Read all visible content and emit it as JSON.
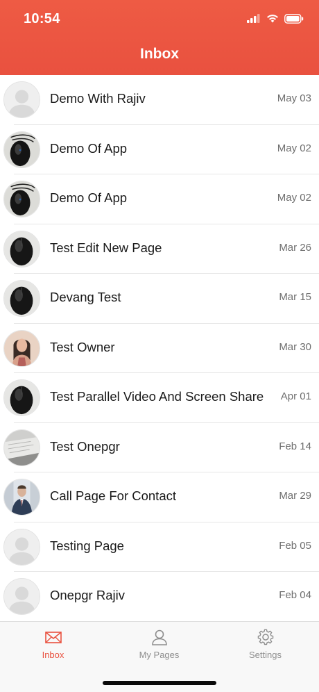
{
  "status_bar": {
    "time": "10:54"
  },
  "header": {
    "title": "Inbox",
    "color": "#e9513f"
  },
  "inbox": {
    "items": [
      {
        "name": "Demo With Rajiv",
        "date": "May 03",
        "avatar": "placeholder"
      },
      {
        "name": "Demo Of App",
        "date": "May 02",
        "avatar": "mouse-cable"
      },
      {
        "name": "Demo Of App",
        "date": "May 02",
        "avatar": "mouse-cable"
      },
      {
        "name": "Test Edit New Page",
        "date": "Mar 26",
        "avatar": "mouse"
      },
      {
        "name": "Devang Test",
        "date": "Mar 15",
        "avatar": "mouse"
      },
      {
        "name": "Test Owner",
        "date": "Mar 30",
        "avatar": "woman-photo"
      },
      {
        "name": "Test Parallel Video And Screen Share",
        "date": "Apr 01",
        "avatar": "mouse"
      },
      {
        "name": "Test Onepgr",
        "date": "Feb 14",
        "avatar": "desk-photo"
      },
      {
        "name": "Call Page For Contact",
        "date": "Mar 29",
        "avatar": "man-photo"
      },
      {
        "name": "Testing Page",
        "date": "Feb 05",
        "avatar": "placeholder"
      },
      {
        "name": "Onepgr Rajiv",
        "date": "Feb 04",
        "avatar": "placeholder"
      }
    ]
  },
  "tabbar": {
    "tabs": [
      {
        "label": "Inbox",
        "icon": "envelope-icon",
        "active": true
      },
      {
        "label": "My Pages",
        "icon": "person-icon",
        "active": false
      },
      {
        "label": "Settings",
        "icon": "gear-icon",
        "active": false
      }
    ],
    "active_color": "#e9513f",
    "inactive_color": "#8e8e8e"
  }
}
